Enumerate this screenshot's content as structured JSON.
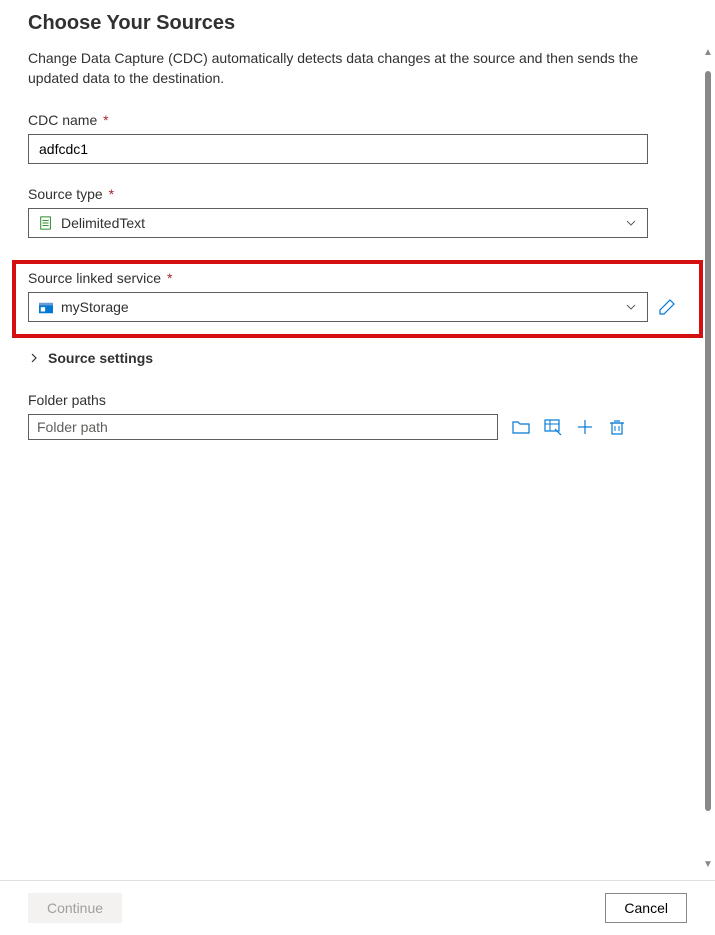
{
  "header": {
    "title": "Choose Your Sources",
    "description": "Change Data Capture (CDC) automatically detects data changes at the source and then sends the updated data to the destination."
  },
  "form": {
    "cdc_name": {
      "label": "CDC name",
      "value": "adfcdc1"
    },
    "source_type": {
      "label": "Source type",
      "value": "DelimitedText"
    },
    "linked_service": {
      "label": "Source linked service",
      "value": "myStorage"
    },
    "source_settings": {
      "label": "Source settings"
    },
    "folder_paths": {
      "label": "Folder paths",
      "placeholder": "Folder path"
    }
  },
  "footer": {
    "continue_label": "Continue",
    "cancel_label": "Cancel"
  },
  "required_marker": "*"
}
